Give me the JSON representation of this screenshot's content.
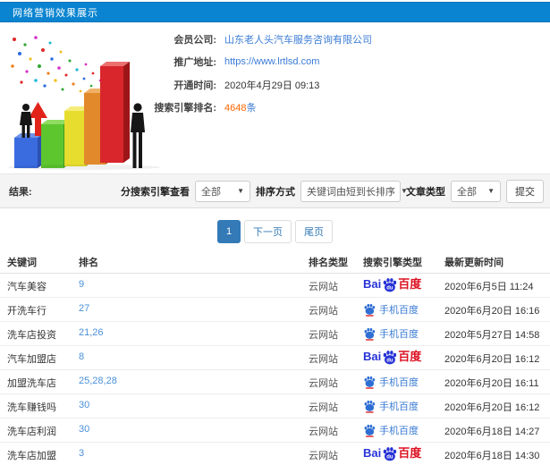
{
  "header": {
    "title": "网络营销效果展示"
  },
  "info": {
    "rows": [
      {
        "label": "会员公司:",
        "value": "山东老人头汽车服务咨询有限公司",
        "kind": "link"
      },
      {
        "label": "推广地址:",
        "value": "https://www.lrtlsd.com",
        "kind": "link"
      },
      {
        "label": "开通时间:",
        "value": "2020年4月29日 09:13",
        "kind": "text"
      },
      {
        "label": "搜索引擎排名:",
        "value": "4648",
        "suffix": "条",
        "kind": "count"
      }
    ]
  },
  "filters": {
    "result_label": "结果:",
    "engine_label": "分搜索引擎查看",
    "engine_value": "全部",
    "sort_label": "排序方式",
    "sort_value": "关键词由短到长排序",
    "type_label": "文章类型",
    "type_value": "全部",
    "submit_label": "提交",
    "caret": "▼"
  },
  "pagination": {
    "current": "1",
    "next_label": "下一页",
    "last_label": "尾页"
  },
  "table": {
    "headers": [
      "关键词",
      "排名",
      "排名类型",
      "搜索引擎类型",
      "最新更新时间"
    ],
    "rows": [
      {
        "keyword": "汽车美容",
        "rank": "9",
        "rank_type": "云网站",
        "engine": "baidu",
        "updated": "2020年6月5日 11:24"
      },
      {
        "keyword": "开洗车行",
        "rank": "27",
        "rank_type": "云网站",
        "engine": "mobile-baidu",
        "updated": "2020年6月20日 16:16"
      },
      {
        "keyword": "洗车店投资",
        "rank": "21,26",
        "rank_type": "云网站",
        "engine": "mobile-baidu",
        "updated": "2020年5月27日 14:58"
      },
      {
        "keyword": "汽车加盟店",
        "rank": "8",
        "rank_type": "云网站",
        "engine": "baidu",
        "updated": "2020年6月20日 16:12"
      },
      {
        "keyword": "加盟洗车店",
        "rank": "25,28,28",
        "rank_type": "云网站",
        "engine": "mobile-baidu",
        "updated": "2020年6月20日 16:11"
      },
      {
        "keyword": "洗车赚钱吗",
        "rank": "30",
        "rank_type": "云网站",
        "engine": "mobile-baidu",
        "updated": "2020年6月20日 16:12"
      },
      {
        "keyword": "洗车店利润",
        "rank": "30",
        "rank_type": "云网站",
        "engine": "mobile-baidu",
        "updated": "2020年6月18日 14:27"
      },
      {
        "keyword": "洗车店加盟",
        "rank": "3",
        "rank_type": "云网站",
        "engine": "baidu",
        "updated": "2020年6月18日 14:30"
      }
    ],
    "engines": {
      "baidu": {
        "prefix": "Bai",
        "paw_text": "du",
        "suffix": "百度"
      },
      "mobile_baidu": {
        "label": "手机百度"
      }
    }
  },
  "colors": {
    "topbar_blue": "#0a84d0",
    "link_blue": "#3a7bd5",
    "count_orange": "#ff6600",
    "pagination_active": "#337ab7",
    "baidu_blue": "#2733d6",
    "baidu_red": "#dc1021"
  }
}
